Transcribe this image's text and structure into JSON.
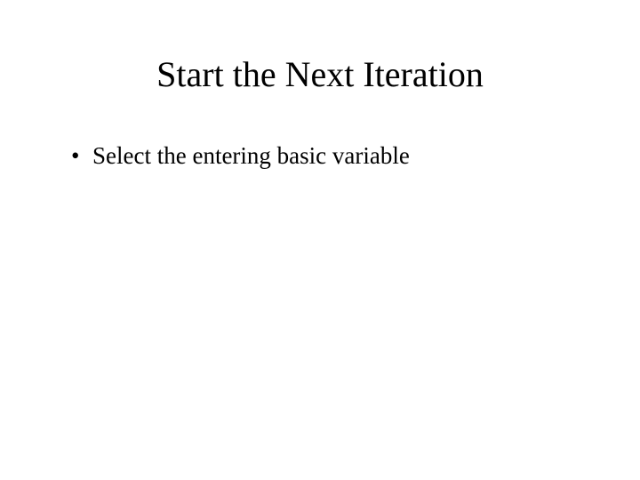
{
  "slide": {
    "title": "Start the Next Iteration",
    "bullets": [
      "Select the entering basic variable"
    ]
  }
}
